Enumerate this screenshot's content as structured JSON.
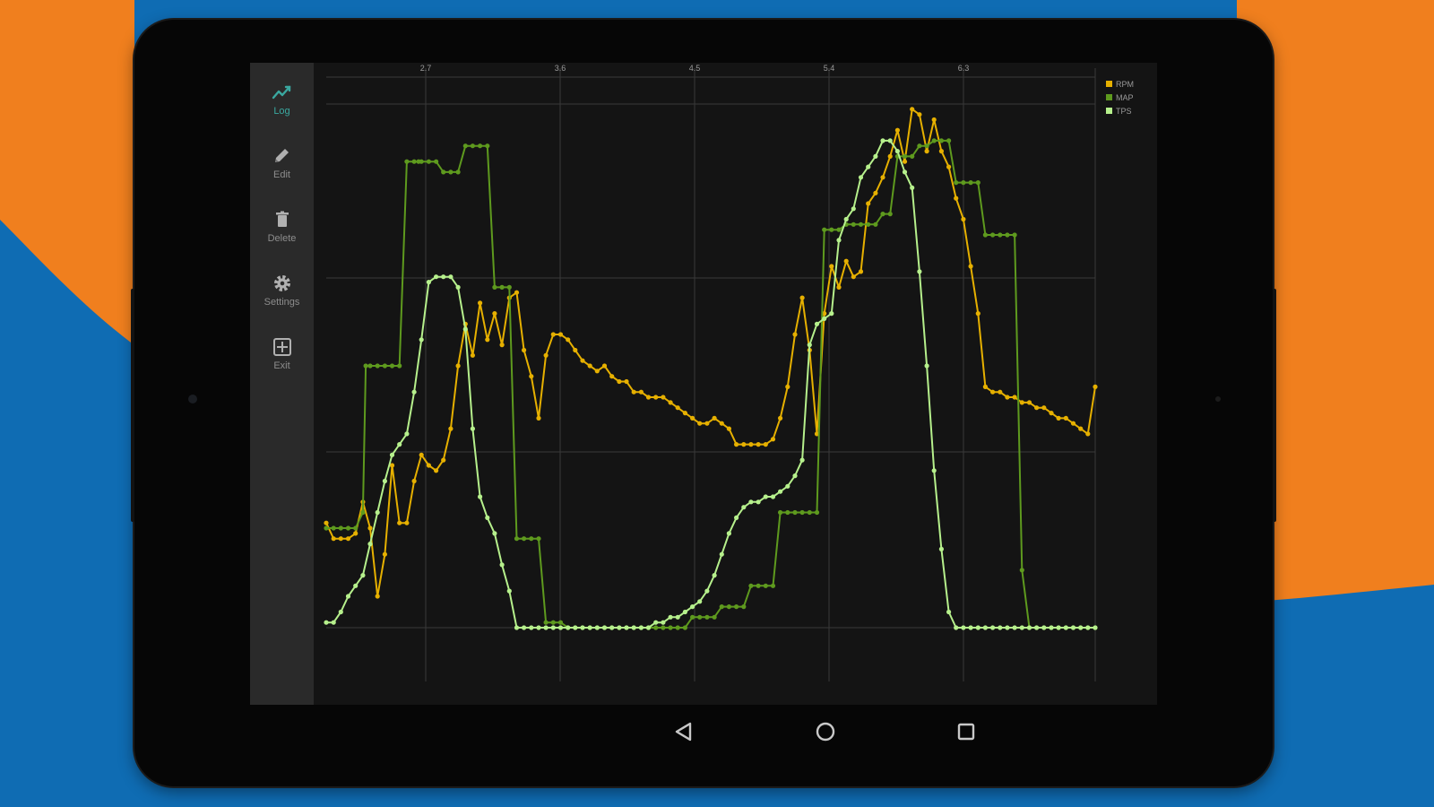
{
  "sidebar": {
    "items": [
      {
        "label": "Log",
        "icon": "line-chart-icon",
        "active": true
      },
      {
        "label": "Edit",
        "icon": "pencil-icon",
        "active": false
      },
      {
        "label": "Delete",
        "icon": "trash-icon",
        "active": false
      },
      {
        "label": "Settings",
        "icon": "gear-icon",
        "active": false
      },
      {
        "label": "Exit",
        "icon": "exit-icon",
        "active": false
      }
    ]
  },
  "navbar": {
    "icons": [
      "back-icon",
      "home-icon",
      "recents-icon"
    ]
  },
  "colors": {
    "background_orange": "#f07f1e",
    "background_blue": "#0f6cb3",
    "accent": "#3aa8a0",
    "rpm": "#e6b000",
    "map": "#5e9a1e",
    "tps": "#b6f08c"
  },
  "chart_data": {
    "type": "line",
    "x_ticks": [
      "2.7",
      "3.6",
      "4.5",
      "5.4",
      "6.3"
    ],
    "xlim": [
      0.75,
      6.0
    ],
    "ylim": [
      0,
      100
    ],
    "grid": true,
    "legend_position": "top-right",
    "series": [
      {
        "name": "RPM",
        "color": "#e6b000",
        "x": [
          0.75,
          0.8,
          0.85,
          0.9,
          0.95,
          1.0,
          1.05,
          1.1,
          1.15,
          1.2,
          1.25,
          1.3,
          1.35,
          1.4,
          1.45,
          1.5,
          1.55,
          1.6,
          1.65,
          1.7,
          1.75,
          1.8,
          1.85,
          1.9,
          1.95,
          2.0,
          2.05,
          2.1,
          2.15,
          2.2,
          2.25,
          2.3,
          2.35,
          2.4,
          2.45,
          2.5,
          2.55,
          2.6,
          2.65,
          2.7,
          2.75,
          2.8,
          2.85,
          2.9,
          2.95,
          3.0,
          3.05,
          3.1,
          3.15,
          3.2,
          3.25,
          3.3,
          3.35,
          3.4,
          3.45,
          3.5,
          3.55,
          3.6,
          3.65,
          3.7,
          3.75,
          3.8,
          3.85,
          3.9,
          3.95,
          4.0,
          4.05,
          4.1,
          4.15,
          4.2,
          4.25,
          4.3,
          4.35,
          4.4,
          4.45,
          4.5,
          4.55,
          4.6,
          4.65,
          4.7,
          4.75,
          4.8,
          4.85,
          4.9,
          4.95,
          5.0,
          5.05,
          5.1,
          5.15,
          5.2,
          5.25,
          5.3,
          5.35,
          5.4,
          5.45,
          5.5,
          5.55,
          5.6,
          5.65,
          5.7,
          5.75,
          5.8,
          5.85,
          5.9,
          5.95,
          6.0
        ],
        "values": [
          20,
          17,
          17,
          17,
          18,
          24,
          19,
          6,
          14,
          31,
          20,
          20,
          28,
          33,
          31,
          30,
          32,
          38,
          50,
          58,
          52,
          62,
          55,
          60,
          54,
          63,
          64,
          53,
          48,
          40,
          52,
          56,
          56,
          55,
          53,
          51,
          50,
          49,
          50,
          48,
          47,
          47,
          45,
          45,
          44,
          44,
          44,
          43,
          42,
          41,
          40,
          39,
          39,
          40,
          39,
          38,
          35,
          35,
          35,
          35,
          35,
          36,
          40,
          46,
          56,
          63,
          53,
          37,
          60,
          69,
          65,
          70,
          67,
          68,
          81,
          83,
          86,
          90,
          95,
          89,
          99,
          98,
          91,
          97,
          91,
          88,
          82,
          78,
          69,
          60,
          46,
          45,
          45,
          44,
          44,
          43,
          43,
          42,
          42,
          41,
          40,
          40,
          39,
          38,
          37,
          46
        ]
      },
      {
        "name": "MAP",
        "color": "#5e9a1e",
        "x": [
          0.75,
          0.8,
          0.85,
          0.9,
          0.95,
          1.0,
          1.02,
          1.05,
          1.1,
          1.15,
          1.2,
          1.25,
          1.3,
          1.35,
          1.38,
          1.4,
          1.45,
          1.5,
          1.55,
          1.6,
          1.65,
          1.7,
          1.75,
          1.8,
          1.85,
          1.9,
          1.95,
          2.0,
          2.05,
          2.1,
          2.15,
          2.2,
          2.25,
          2.3,
          2.35,
          2.4,
          2.45,
          2.5,
          2.55,
          2.6,
          2.65,
          2.7,
          2.75,
          2.8,
          2.85,
          2.9,
          2.95,
          3.0,
          3.05,
          3.1,
          3.15,
          3.2,
          3.25,
          3.3,
          3.35,
          3.4,
          3.45,
          3.5,
          3.55,
          3.6,
          3.65,
          3.7,
          3.75,
          3.8,
          3.85,
          3.9,
          3.95,
          4.0,
          4.05,
          4.1,
          4.15,
          4.2,
          4.25,
          4.3,
          4.35,
          4.4,
          4.45,
          4.5,
          4.55,
          4.6,
          4.65,
          4.7,
          4.75,
          4.8,
          4.85,
          4.9,
          4.95,
          5.0,
          5.05,
          5.1,
          5.15,
          5.2,
          5.25,
          5.3,
          5.35,
          5.4,
          5.45,
          5.5,
          5.55,
          5.6,
          5.65,
          5.7,
          5.75,
          5.8,
          5.85,
          5.9,
          5.95,
          6.0
        ],
        "values": [
          19,
          19,
          19,
          19,
          19,
          22,
          50,
          50,
          50,
          50,
          50,
          50,
          89,
          89,
          89,
          89,
          89,
          89,
          87,
          87,
          87,
          92,
          92,
          92,
          92,
          65,
          65,
          65,
          17,
          17,
          17,
          17,
          1,
          1,
          1,
          0,
          0,
          0,
          0,
          0,
          0,
          0,
          0,
          0,
          0,
          0,
          0,
          0,
          0,
          0,
          0,
          0,
          2,
          2,
          2,
          2,
          4,
          4,
          4,
          4,
          8,
          8,
          8,
          8,
          22,
          22,
          22,
          22,
          22,
          22,
          76,
          76,
          76,
          77,
          77,
          77,
          77,
          77,
          79,
          79,
          90,
          90,
          90,
          92,
          92,
          93,
          93,
          93,
          85,
          85,
          85,
          85,
          75,
          75,
          75,
          75,
          75,
          11,
          0,
          0,
          0,
          0,
          0,
          0,
          0,
          0,
          0,
          0
        ]
      },
      {
        "name": "TPS",
        "color": "#b6f08c",
        "x": [
          0.75,
          0.8,
          0.85,
          0.9,
          0.95,
          1.0,
          1.05,
          1.1,
          1.15,
          1.2,
          1.25,
          1.3,
          1.35,
          1.4,
          1.45,
          1.5,
          1.55,
          1.6,
          1.65,
          1.7,
          1.75,
          1.8,
          1.85,
          1.9,
          1.95,
          2.0,
          2.05,
          2.1,
          2.15,
          2.2,
          2.25,
          2.3,
          2.35,
          2.4,
          2.45,
          2.5,
          2.55,
          2.6,
          2.65,
          2.7,
          2.75,
          2.8,
          2.85,
          2.9,
          2.95,
          3.0,
          3.05,
          3.1,
          3.15,
          3.2,
          3.25,
          3.3,
          3.35,
          3.4,
          3.45,
          3.5,
          3.55,
          3.6,
          3.65,
          3.7,
          3.75,
          3.8,
          3.85,
          3.9,
          3.95,
          4.0,
          4.05,
          4.1,
          4.15,
          4.2,
          4.25,
          4.3,
          4.35,
          4.4,
          4.45,
          4.5,
          4.55,
          4.6,
          4.65,
          4.7,
          4.75,
          4.8,
          4.85,
          4.9,
          4.95,
          5.0,
          5.05,
          5.1,
          5.15,
          5.2,
          5.25,
          5.3,
          5.35,
          5.4,
          5.45,
          5.5,
          5.55,
          5.6,
          5.65,
          5.7,
          5.75,
          5.8,
          5.85,
          5.9,
          5.95,
          6.0
        ],
        "values": [
          1,
          1,
          3,
          6,
          8,
          10,
          16,
          22,
          28,
          33,
          35,
          37,
          45,
          55,
          66,
          67,
          67,
          67,
          65,
          57,
          38,
          25,
          21,
          18,
          12,
          7,
          0,
          0,
          0,
          0,
          0,
          0,
          0,
          0,
          0,
          0,
          0,
          0,
          0,
          0,
          0,
          0,
          0,
          0,
          0,
          1,
          1,
          2,
          2,
          3,
          4,
          5,
          7,
          10,
          14,
          18,
          21,
          23,
          24,
          24,
          25,
          25,
          26,
          27,
          29,
          32,
          54,
          58,
          59,
          60,
          74,
          78,
          80,
          86,
          88,
          90,
          93,
          93,
          91,
          87,
          84,
          68,
          50,
          30,
          15,
          3,
          0,
          0,
          0,
          0,
          0,
          0,
          0,
          0,
          0,
          0,
          0,
          0,
          0,
          0,
          0,
          0,
          0,
          0,
          0,
          0
        ]
      }
    ]
  }
}
